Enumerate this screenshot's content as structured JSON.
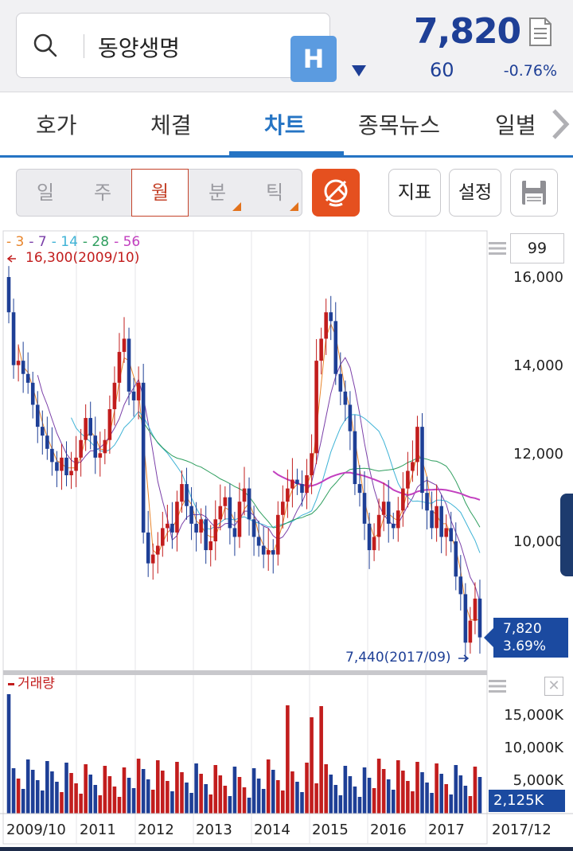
{
  "header": {
    "stock_name": "동양생명",
    "badge": "H",
    "price": "7,820",
    "change": "60",
    "change_pct": "-0.76%"
  },
  "tabs": [
    {
      "label": "호가"
    },
    {
      "label": "체결"
    },
    {
      "label": "차트",
      "active": true
    },
    {
      "label": "종목뉴스"
    },
    {
      "label": "일별"
    }
  ],
  "toolbar": {
    "periods": [
      "일",
      "주",
      "월",
      "분",
      "틱"
    ],
    "active_period": "월",
    "indicator_label": "지표",
    "settings_label": "설정"
  },
  "chart": {
    "ma_legend": [
      {
        "label": "3",
        "color": "#e8852b"
      },
      {
        "label": "7",
        "color": "#7a3fa8"
      },
      {
        "label": "14",
        "color": "#3fb3d6"
      },
      {
        "label": "28",
        "color": "#2e9e5e"
      },
      {
        "label": "56",
        "color": "#c23fbf"
      }
    ],
    "count": "99",
    "high_label": "16,300(2009/10)",
    "low_label": "7,440(2017/09)",
    "current_price": "7,820",
    "current_pct": "3.69%",
    "y_ticks": [
      "16,000",
      "14,000",
      "12,000",
      "10,000"
    ],
    "volume_title": "거래량",
    "vol_ticks": [
      "15,000K",
      "10,000K",
      "5,000K"
    ],
    "current_volume": "2,125K",
    "x_ticks": [
      "2009/10",
      "2011",
      "2012",
      "2013",
      "2014",
      "2015",
      "2016",
      "2017",
      "2017/12"
    ]
  },
  "colors": {
    "up": "#c21d1d",
    "down": "#1e3f96",
    "accent": "#2574c4",
    "ai_button": "#e5501f"
  }
}
